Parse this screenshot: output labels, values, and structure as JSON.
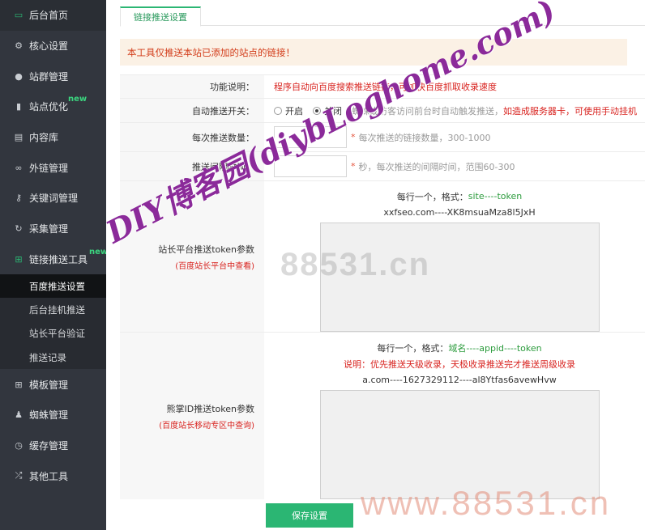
{
  "sidebar": {
    "items": [
      {
        "label": "后台首页",
        "icon": "monitor-icon",
        "new": ""
      },
      {
        "label": "核心设置",
        "icon": "gear-icon",
        "new": ""
      },
      {
        "label": "站群管理",
        "icon": "user-icon",
        "new": ""
      },
      {
        "label": "站点优化",
        "icon": "bar-chart-icon",
        "new": "new"
      },
      {
        "label": "内容库",
        "icon": "document-icon",
        "new": ""
      },
      {
        "label": "外链管理",
        "icon": "link-icon",
        "new": ""
      },
      {
        "label": "关键词管理",
        "icon": "key-icon",
        "new": ""
      },
      {
        "label": "采集管理",
        "icon": "refresh-icon",
        "new": ""
      },
      {
        "label": "链接推送工具",
        "icon": "windows-icon",
        "new": "new"
      }
    ],
    "subitems": [
      "百度推送设置",
      "后台挂机推送",
      "站长平台验证",
      "推送记录"
    ],
    "items_after": [
      {
        "label": "模板管理",
        "icon": "windows-icon"
      },
      {
        "label": "蜘蛛管理",
        "icon": "android-icon"
      },
      {
        "label": "缓存管理",
        "icon": "clock-icon"
      },
      {
        "label": "其他工具",
        "icon": "shuffle-icon"
      }
    ]
  },
  "tab": {
    "label": "链接推送设置"
  },
  "notice": "本工具仅推送本站已添加的站点的链接！",
  "form": {
    "desc": {
      "label": "功能说明：",
      "text": "程序自动向百度搜索推送链接，可加快百度抓取收录速度"
    },
    "auto": {
      "label": "自动推送开关：",
      "on": "开启",
      "off": "关闭",
      "hint": "蜘蛛或访客访问前台时自动触发推送，",
      "hint_red": "如造成服务器卡，可使用手动挂机"
    },
    "count": {
      "label": "每次推送数量：",
      "hint": "每次推送的链接数量，300-1000"
    },
    "interval": {
      "label": "推送间隔时间：",
      "hint": "秒，每次推送的间隔时间，范围60-300"
    },
    "token": {
      "label": "站长平台推送token参数",
      "sub": "(百度站长平台中查看)",
      "format_prefix": "每行一个，格式：",
      "format": "site----token",
      "example": "xxfseo.com----XK8msuaMza8l5JxH"
    },
    "xzh": {
      "label": "熊掌ID推送token参数",
      "sub": "(百度站长移动专区中查询)",
      "format_prefix": "每行一个，格式：",
      "format": "域名----appid----token",
      "note": "说明：优先推送天级收录，天极收录推送完才推送周级收录",
      "example": "a.com----1627329112----al8Ytfas6avewHvw"
    },
    "save": "保存设置"
  },
  "watermarks": {
    "diy": "DIY博客园(diybLoghome.com)",
    "num1": "88531.cn",
    "num2": "www.88531.cn"
  },
  "colors": {
    "accent": "#2bb673",
    "sidebar": "#32363e",
    "notice_bg": "#fbf1e5",
    "error": "#d8231f",
    "watermark": "#8b2a9a"
  }
}
